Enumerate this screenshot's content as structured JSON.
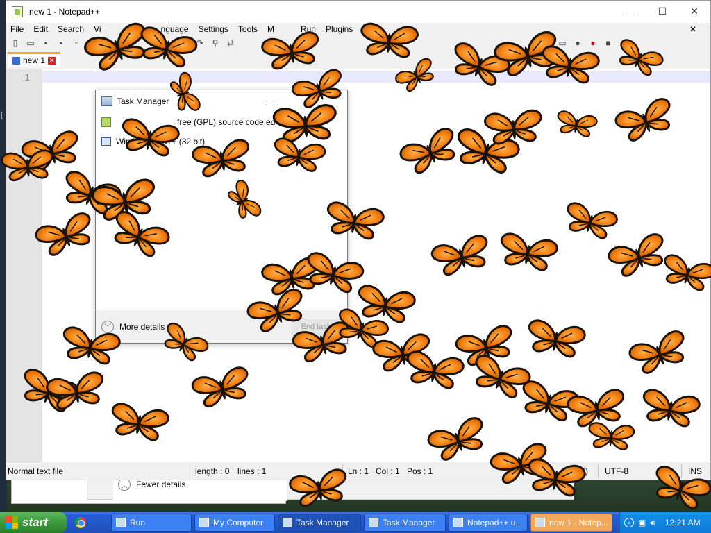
{
  "window": {
    "title": "new 1 - Notepad++",
    "controls": [
      "—",
      "☐",
      "✕"
    ]
  },
  "menu": {
    "items": [
      "File",
      "Edit",
      "Search",
      "Vi",
      "nguage",
      "Settings",
      "Tools",
      "M",
      "Run",
      "Plugins"
    ],
    "close": "✕"
  },
  "tab": {
    "label": "new 1"
  },
  "editor": {
    "line_number": "1"
  },
  "statusbar": {
    "file_type": "Normal text file",
    "length": "length : 0",
    "lines": "lines : 1",
    "ln": "Ln : 1",
    "col": "Col : 1",
    "pos": "Pos : 1",
    "eol": "R LF)",
    "encoding": "UTF-8",
    "mode": "INS"
  },
  "task_manager": {
    "title": "Task Manager",
    "rows": [
      {
        "icon": "notepad-icon",
        "text": "free (GPL) source code ed"
      },
      {
        "icon": "wingup-icon",
        "text": "WinGup  epad++ (32 bit)"
      }
    ],
    "more_details": "More details",
    "end_task": "End task"
  },
  "background_window": {
    "fewer_details": "Fewer details"
  },
  "taskbar": {
    "start": "start",
    "buttons": [
      {
        "label": "Run",
        "state": "normal"
      },
      {
        "label": "My Computer",
        "state": "normal"
      },
      {
        "label": "Task Manager",
        "state": "active"
      },
      {
        "label": "Task Manager",
        "state": "normal"
      },
      {
        "label": "Notepad++ u...",
        "state": "normal"
      },
      {
        "label": "new 1 - Notep...",
        "state": "highlight"
      }
    ],
    "clock": "12:21 AM"
  },
  "colors": {
    "butterfly_orange": "#f07d10",
    "butterfly_black": "#1a1206",
    "taskbar_blue": "#245edb",
    "tab_accent": "#f6a21a"
  }
}
